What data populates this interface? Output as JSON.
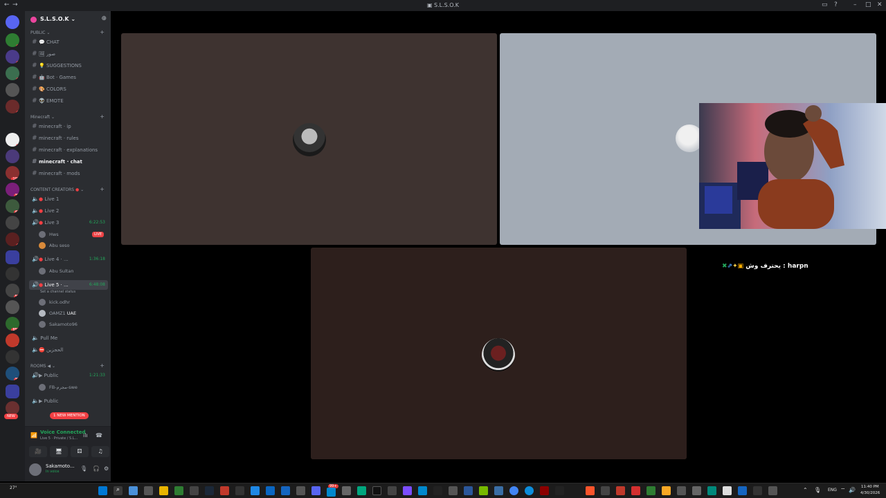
{
  "window": {
    "title": "S.L.S.O.K"
  },
  "server": {
    "name": "S.L.S.O.K"
  },
  "categories": {
    "public": "PUBLIC",
    "minecraft": "Minecraft",
    "content": "CONTENT CREATORS",
    "rooms": "ROOMS"
  },
  "public_channels": [
    {
      "label": "CHAT",
      "emoji": "💬"
    },
    {
      "label": "صور",
      "emoji": "🖼"
    },
    {
      "label": "SUGGESTIONS",
      "emoji": "💡"
    },
    {
      "label": "Bot · Games",
      "emoji": "🤖"
    },
    {
      "label": "COLORS",
      "emoji": "🎨"
    },
    {
      "label": "EMOTE",
      "emoji": "👽"
    }
  ],
  "minecraft_channels": [
    {
      "label": "minecraft · ip"
    },
    {
      "label": "minecraft · rules"
    },
    {
      "label": "minecraft · explanations"
    },
    {
      "label": "minecraft · chat"
    },
    {
      "label": "minecraft · mods"
    }
  ],
  "voice": {
    "live1": "Live 1",
    "live2": "Live 2",
    "live3": "Live 3",
    "live3_timer": "6:22:53",
    "live3_user1": "Hws",
    "live3_user2": "Abu seso",
    "live4": "Live 4 · ...",
    "live4_timer": "1:36:18",
    "live4_user1": "Abu Sultan",
    "live5": "Live 5 · ...",
    "live5_timer": "6:48:08",
    "live5_status": "Set a channel status",
    "live5_user1": "kick.odhr",
    "live5_user2": "OAMZ1",
    "live5_user2_tag": "UAE",
    "live5_user3": "Sakamoto96",
    "pullme": "Pull Me",
    "arabic_room": "الحجزين",
    "public1": "Public",
    "public1_timer": "1:21:33",
    "public1_user": "FB-مجرم-swe",
    "public2": "Public",
    "live_badge": "LIVE"
  },
  "mention_badge": "1 NEW MENTION",
  "new_badge": "NEW",
  "voice_panel": {
    "status": "Voice Connected",
    "channel": "Live 5 · Private / S.L..."
  },
  "user_panel": {
    "name": "Sakamoto...",
    "status": "In voice"
  },
  "overlay": {
    "text": "يحترف وش : harpn"
  },
  "taskbar": {
    "weather": "27°",
    "time": "11:40 PM",
    "date": "4/30/2026",
    "badge": "99+"
  },
  "colors": {
    "tile1": "#3e3330",
    "tile2": "#a3abb5",
    "tile3": "#2d1f1c",
    "accent_green": "#23a55a",
    "danger": "#f23f43"
  }
}
